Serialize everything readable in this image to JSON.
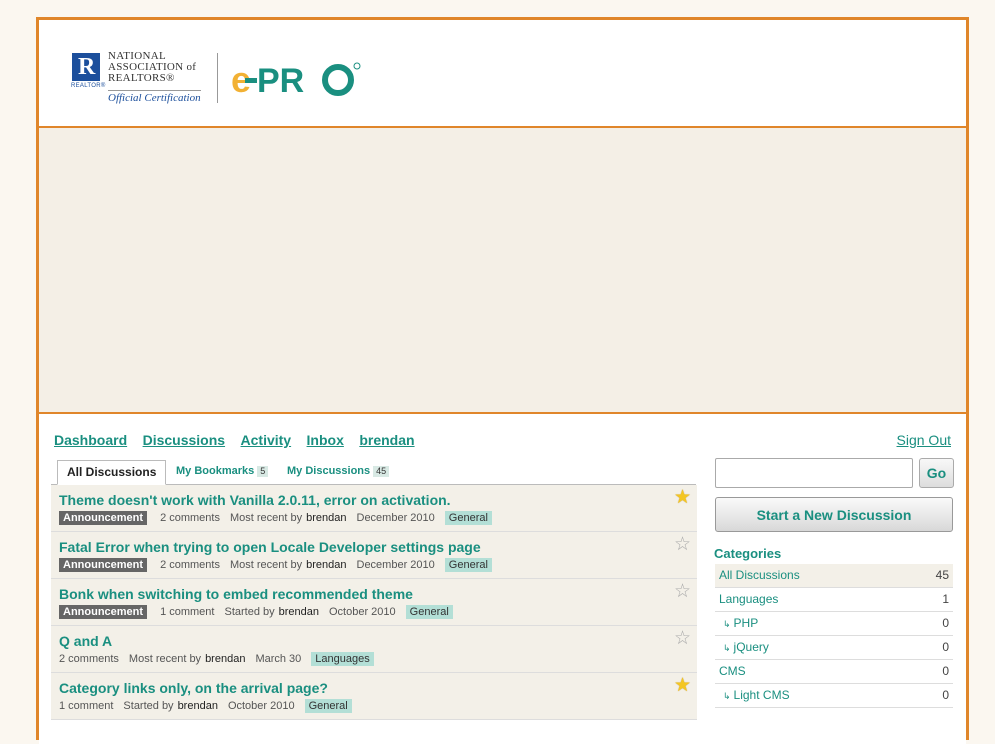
{
  "logo": {
    "nar_lines": [
      "NATIONAL",
      "ASSOCIATION of",
      "REALTORS®"
    ],
    "realtor_mark": "REALTOR®",
    "certification": "Official Certification",
    "epro": "e-PRO"
  },
  "nav": {
    "items": [
      "Dashboard",
      "Discussions",
      "Activity",
      "Inbox",
      "brendan"
    ],
    "sign_out": "Sign Out"
  },
  "tabs": [
    {
      "label": "All Discussions"
    },
    {
      "label": "My Bookmarks",
      "count": "5"
    },
    {
      "label": "My Discussions",
      "count": "45"
    }
  ],
  "discussions": [
    {
      "title": "Theme doesn't work with Vanilla 2.0.11, error on activation.",
      "announcement": "Announcement",
      "comments": "2 comments",
      "activity": "Most recent by",
      "user": "brendan",
      "date": "December 2010",
      "category": "General",
      "bookmarked": true
    },
    {
      "title": "Fatal Error when trying to open Locale Developer settings page",
      "announcement": "Announcement",
      "comments": "2 comments",
      "activity": "Most recent by",
      "user": "brendan",
      "date": "December 2010",
      "category": "General",
      "bookmarked": false
    },
    {
      "title": "Bonk when switching to embed recommended theme",
      "announcement": "Announcement",
      "comments": "1 comment",
      "activity": "Started by",
      "user": "brendan",
      "date": "October 2010",
      "category": "General",
      "bookmarked": false
    },
    {
      "title": "Q and A",
      "announcement": "",
      "comments": "2 comments",
      "activity": "Most recent by",
      "user": "brendan",
      "date": "March 30",
      "category": "Languages",
      "bookmarked": false
    },
    {
      "title": "Category links only, on the arrival page?",
      "announcement": "",
      "comments": "1 comment",
      "activity": "Started by",
      "user": "brendan",
      "date": "October 2010",
      "category": "General",
      "bookmarked": true
    }
  ],
  "sidebar": {
    "search_value": "",
    "go_label": "Go",
    "new_discussion": "Start a New Discussion",
    "categories_heading": "Categories",
    "categories": [
      {
        "name": "All Discussions",
        "count": "45"
      },
      {
        "name": "Languages",
        "count": "1"
      },
      {
        "name": "PHP",
        "count": "0",
        "sub": true
      },
      {
        "name": "jQuery",
        "count": "0",
        "sub": true
      },
      {
        "name": "CMS",
        "count": "0"
      },
      {
        "name": "Light CMS",
        "count": "0",
        "sub": true
      }
    ]
  },
  "colors": {
    "accent": "#1a8f80",
    "border": "#e0862a",
    "announcement": "#666666",
    "category": "#b3dfd6",
    "star": "#f4c622"
  }
}
